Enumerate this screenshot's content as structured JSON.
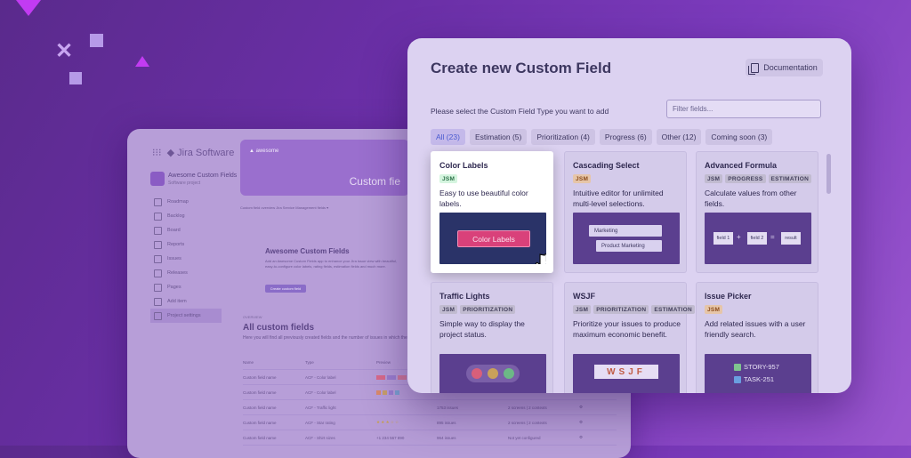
{
  "jira": {
    "logo": "Jira Software",
    "project_name": "Awesome Custom Fields",
    "project_sub": "Software project",
    "nav": [
      "Roadmap",
      "Backlog",
      "Board",
      "Reports",
      "Issues",
      "Releases",
      "Pages",
      "Add item",
      "Project settings"
    ],
    "banner_logo": "awesome",
    "banner_title": "Custom fie",
    "tabs": "Custom field overview     Jira Service Management fields ▾",
    "intro_title": "Awesome Custom Fields",
    "intro_text": "Add an Awesome Custom Fields app to enhance your Jira issue view with beautiful, easy-to-configure color labels, rating fields, estimation fields and much more.",
    "intro_button": "Create custom field",
    "overview_label": "OVERVIEW",
    "all_title": "All custom fields",
    "all_sub": "Here you will find all previously created fields and the number of issues in which they are used.",
    "table_headers": [
      "Name",
      "Type",
      "Preview",
      "",
      "",
      ""
    ],
    "rows": [
      [
        "Custom field name",
        "ACF - Color label",
        "",
        "",
        "",
        ""
      ],
      [
        "Custom field name",
        "ACF - Color label",
        "",
        "",
        "",
        ""
      ],
      [
        "Custom field name",
        "ACF - Traffic light",
        "",
        "1753 issues",
        "2 screens | 2 contexts",
        "⚙"
      ],
      [
        "Custom field name",
        "ACF - Star rating",
        "★ ★ ★ ☆ ☆",
        "895 issues",
        "2 screens | 2 contexts",
        "⚙"
      ],
      [
        "Custom field name",
        "ACF - Shirt sizes",
        "+1 234 567 890",
        "964 issues",
        "Not yet configured",
        "⚙"
      ]
    ]
  },
  "modal": {
    "title": "Create new Custom Field",
    "doc_button": "Documentation",
    "prompt": "Please select the Custom Field Type you want to add",
    "filter_placeholder": "Filter fields...",
    "tabs": [
      {
        "label": "All (23)"
      },
      {
        "label": "Estimation (5)"
      },
      {
        "label": "Prioritization (4)"
      },
      {
        "label": "Progress (6)"
      },
      {
        "label": "Other (12)"
      },
      {
        "label": "Coming soon (3)"
      }
    ],
    "cards": [
      {
        "title": "Color Labels",
        "badges": [
          "JSM"
        ],
        "desc": "Easy to use beautiful color labels.",
        "preview_label": "Color Labels"
      },
      {
        "title": "Cascading Select",
        "badges": [
          "JSM"
        ],
        "desc": "Intuitive editor for unlimited multi-level selections.",
        "preview_a": "Marketing",
        "preview_b": "Product Marketing"
      },
      {
        "title": "Advanced Formula",
        "badges": [
          "JSM",
          "PROGRESS",
          "ESTIMATION"
        ],
        "desc": "Calculate values from other fields.",
        "preview_f1": "field 1",
        "preview_f2": "field 2",
        "preview_res": "result"
      },
      {
        "title": "Traffic Lights",
        "badges": [
          "JSM",
          "PRIORITIZATION"
        ],
        "desc": "Simple way to display the project status."
      },
      {
        "title": "WSJF",
        "badges": [
          "JSM",
          "PRIORITIZATION",
          "ESTIMATION"
        ],
        "desc": "Prioritize your issues to produce maximum economic benefit.",
        "preview_label": "WSJF"
      },
      {
        "title": "Issue Picker",
        "badges": [
          "JSM"
        ],
        "desc": "Add related issues with a user friendly search.",
        "preview_a": "STORY-957",
        "preview_b": "TASK-251"
      }
    ]
  },
  "colors": {
    "accent": "#4a5bd0",
    "color_label": "#d9417a",
    "background": "#6a2fa6"
  }
}
